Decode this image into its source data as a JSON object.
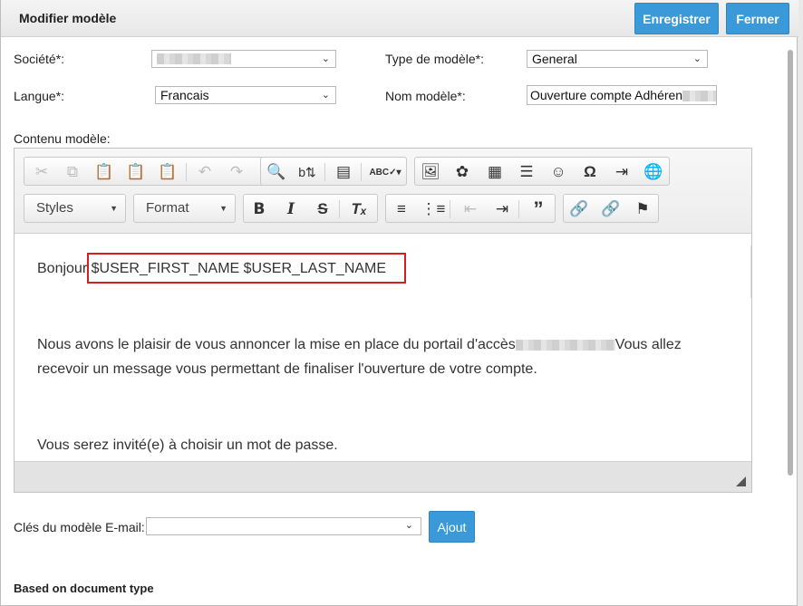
{
  "dialog": {
    "title": "Modifier modèle",
    "save_label": "Enregistrer",
    "close_label": "Fermer"
  },
  "form": {
    "societe_label": "Société*:",
    "societe_value": "",
    "type_label": "Type de modèle*:",
    "type_value": "General",
    "langue_label": "Langue*:",
    "langue_value": "Francais",
    "nom_label": "Nom modèle*:",
    "nom_value": "Ouverture compte Adhéren",
    "contenu_label": "Contenu modèle:"
  },
  "editor": {
    "toolbar_row1": [
      "cut-icon",
      "copy-icon",
      "paste-icon",
      "paste-text-icon",
      "paste-word-icon",
      "undo-icon",
      "redo-icon",
      "find-icon",
      "replace-icon",
      "select-all-icon",
      "spellcheck-icon",
      "image-icon",
      "flash-icon",
      "table-icon",
      "horizontal-rule-icon",
      "smiley-icon",
      "special-char-icon",
      "page-break-icon",
      "iframe-icon"
    ],
    "toolbar_row2": [
      "bold-icon",
      "italic-icon",
      "strike-icon",
      "remove-format-icon",
      "numbered-list-icon",
      "bulleted-list-icon",
      "outdent-icon",
      "indent-icon",
      "blockquote-icon",
      "link-icon",
      "unlink-icon",
      "anchor-icon"
    ],
    "styles_label": "Styles",
    "format_label": "Format",
    "spellcheck_glyph": "ABC",
    "content": {
      "greeting": "Bonjour",
      "placeholder_vars": "$USER_FIRST_NAME $USER_LAST_NAME",
      "para1_line1_start": "Nous avons le plaisir de vous annoncer la mise en place du portail d'accès",
      "para1_line1_end": "Vous allez",
      "para1_line2": "recevoir un message vous permettant de finaliser l'ouverture de votre compte.",
      "para2": "Vous serez invité(e) à choisir un mot de passe."
    }
  },
  "keys": {
    "label": "Clés du modèle E-mail:",
    "value": "",
    "add_label": "Ajout"
  },
  "section": {
    "title": "Based on document type"
  },
  "colors": {
    "primary_button": "#3a9ad9",
    "highlight_border": "#d21f1f"
  }
}
